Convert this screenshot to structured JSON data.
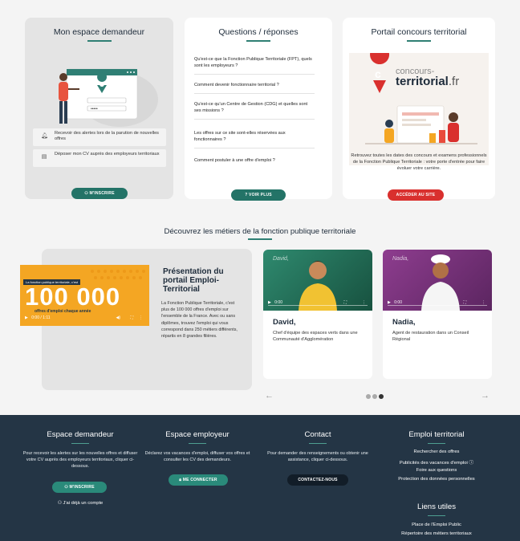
{
  "cards": {
    "espace": {
      "title": "Mon espace demandeur",
      "alerts": [
        "Recevoir des alertes lors de la parution de nouvelles offres",
        "Déposer mon CV auprès des employeurs territoriaux"
      ],
      "button": "M'INSCRIRE"
    },
    "qa": {
      "title": "Questions / réponses",
      "items": [
        "Qu'est-ce que la Fonction Publique Territoriale (FPT), quels sont les employeurs ?",
        "Comment devenir fonctionnaire territorial ?",
        "Qu'est-ce qu'un Centre de Gestion (CDG) et quelles sont ses missions ?",
        "Les offres sur ce site sont-elles réservées aux fonctionnaires ?",
        "Comment postuler à une offre d'emploi ?"
      ],
      "button": "VOIR PLUS"
    },
    "portail": {
      "title": "Portail concours territorial",
      "logo_top": "concours-",
      "logo_main": "territorial",
      "logo_tld": ".fr",
      "text": "Retrouvez toutes les dates des concours et examens professionnels de la Fonction Publique Territoriale : votre porte d'entrée pour faire évoluer votre carrière.",
      "button": "ACCÉDER AU SITE"
    }
  },
  "metiers": {
    "heading": "Découvrez les métiers de la fonction publique territoriale",
    "presentation": {
      "title": "Présentation du portail Emploi-Territorial",
      "text": "La Fonction Publique Territoriale, c'est plus de 100 000 offres d'emploi sur l'ensemble de la France. Avec ou sans diplômes, trouvez l'emploi qui vous correspond dans 250 métiers différents, répartis en 8 grandes filières.",
      "video_badge": "La fonction publique territoriale, c'est",
      "video_big": "100 000",
      "video_caption": "offres d'emploi chaque année",
      "video_time": "0:00 / 1:11"
    },
    "videos": [
      {
        "name": "David,",
        "desc": "Chef d'équipe des espaces verts dans une Communauté d'Agglomération",
        "overlay": "David,",
        "time": "0:00"
      },
      {
        "name": "Nadia,",
        "desc": "Agent de restauration dans un Conseil Régional",
        "overlay": "Nadia,",
        "time": "0:00"
      }
    ],
    "prev": "←",
    "next": "→"
  },
  "footer": {
    "demandeur": {
      "title": "Espace demandeur",
      "text": "Pour recevoir les alertes sur les nouvelles offres et diffuser votre CV auprès des employeurs territoriaux, cliquer ci-dessous.",
      "button": "M'INSCRIRE",
      "link": "J'ai déjà un compte"
    },
    "employeur": {
      "title": "Espace employeur",
      "text": "Déclarez vos vacances d'emploi, diffuser vos offres et consulter les CV des demandeurs.",
      "button": "ME CONNECTER"
    },
    "contact": {
      "title": "Contact",
      "text": "Pour demander des renseignements ou obtenir une assistance, cliquer ci-dessous.",
      "button": "CONTACTEZ-NOUS"
    },
    "emploi": {
      "title": "Emploi territorial",
      "links": [
        "Rechercher des offres",
        "Publicités des vacances d'emploi ⓘ",
        "Foire aux questions",
        "Protection des données personnelles"
      ]
    },
    "liens": {
      "title": "Liens utiles",
      "links": [
        "Place de l'Emploi Public",
        "Répertoire des métiers territoriaux"
      ]
    }
  },
  "colors": {
    "brand_green": "#237367",
    "brand_red": "#d9302e",
    "footer_bg": "#243545"
  }
}
